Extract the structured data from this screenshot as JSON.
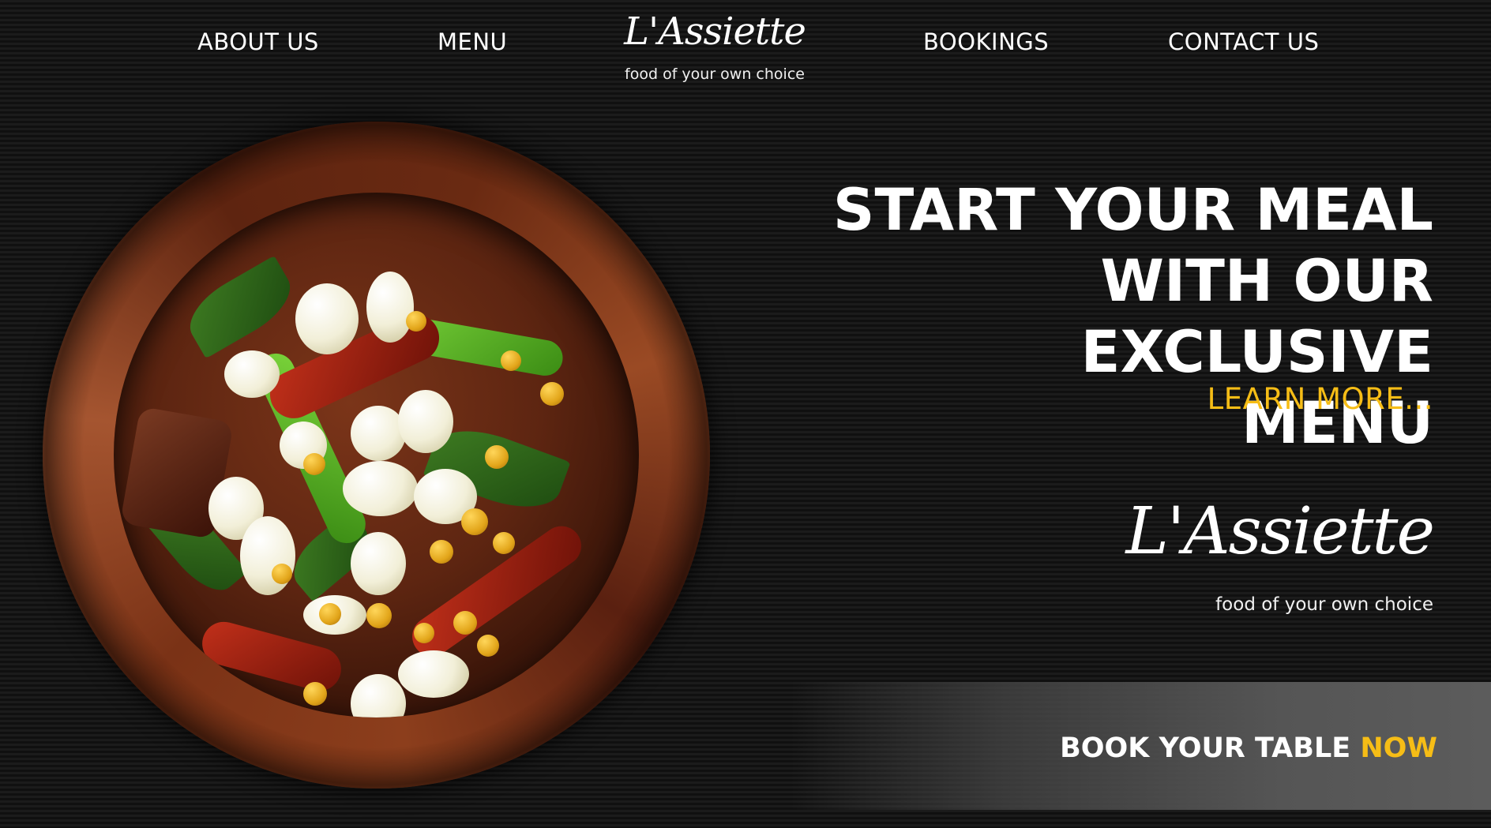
{
  "nav": {
    "about": "ABOUT US",
    "menu": "MENU",
    "bookings": "BOOKINGS",
    "contact": "CONTACT US"
  },
  "brand": {
    "name": "L'Assiette",
    "tagline": "food of your own choice"
  },
  "hero": {
    "line1": "START YOUR MEAL",
    "line2": "WITH OUR EXCLUSIVE",
    "line3": "MENU",
    "learn_more": "LEARN MORE..."
  },
  "cta": {
    "label": "BOOK YOUR TABLE",
    "accent": "NOW"
  },
  "colors": {
    "accent": "#f6bd16",
    "background": "#141414",
    "text": "#ffffff"
  },
  "icons": {
    "hero_image": "bowl-of-food-image"
  }
}
